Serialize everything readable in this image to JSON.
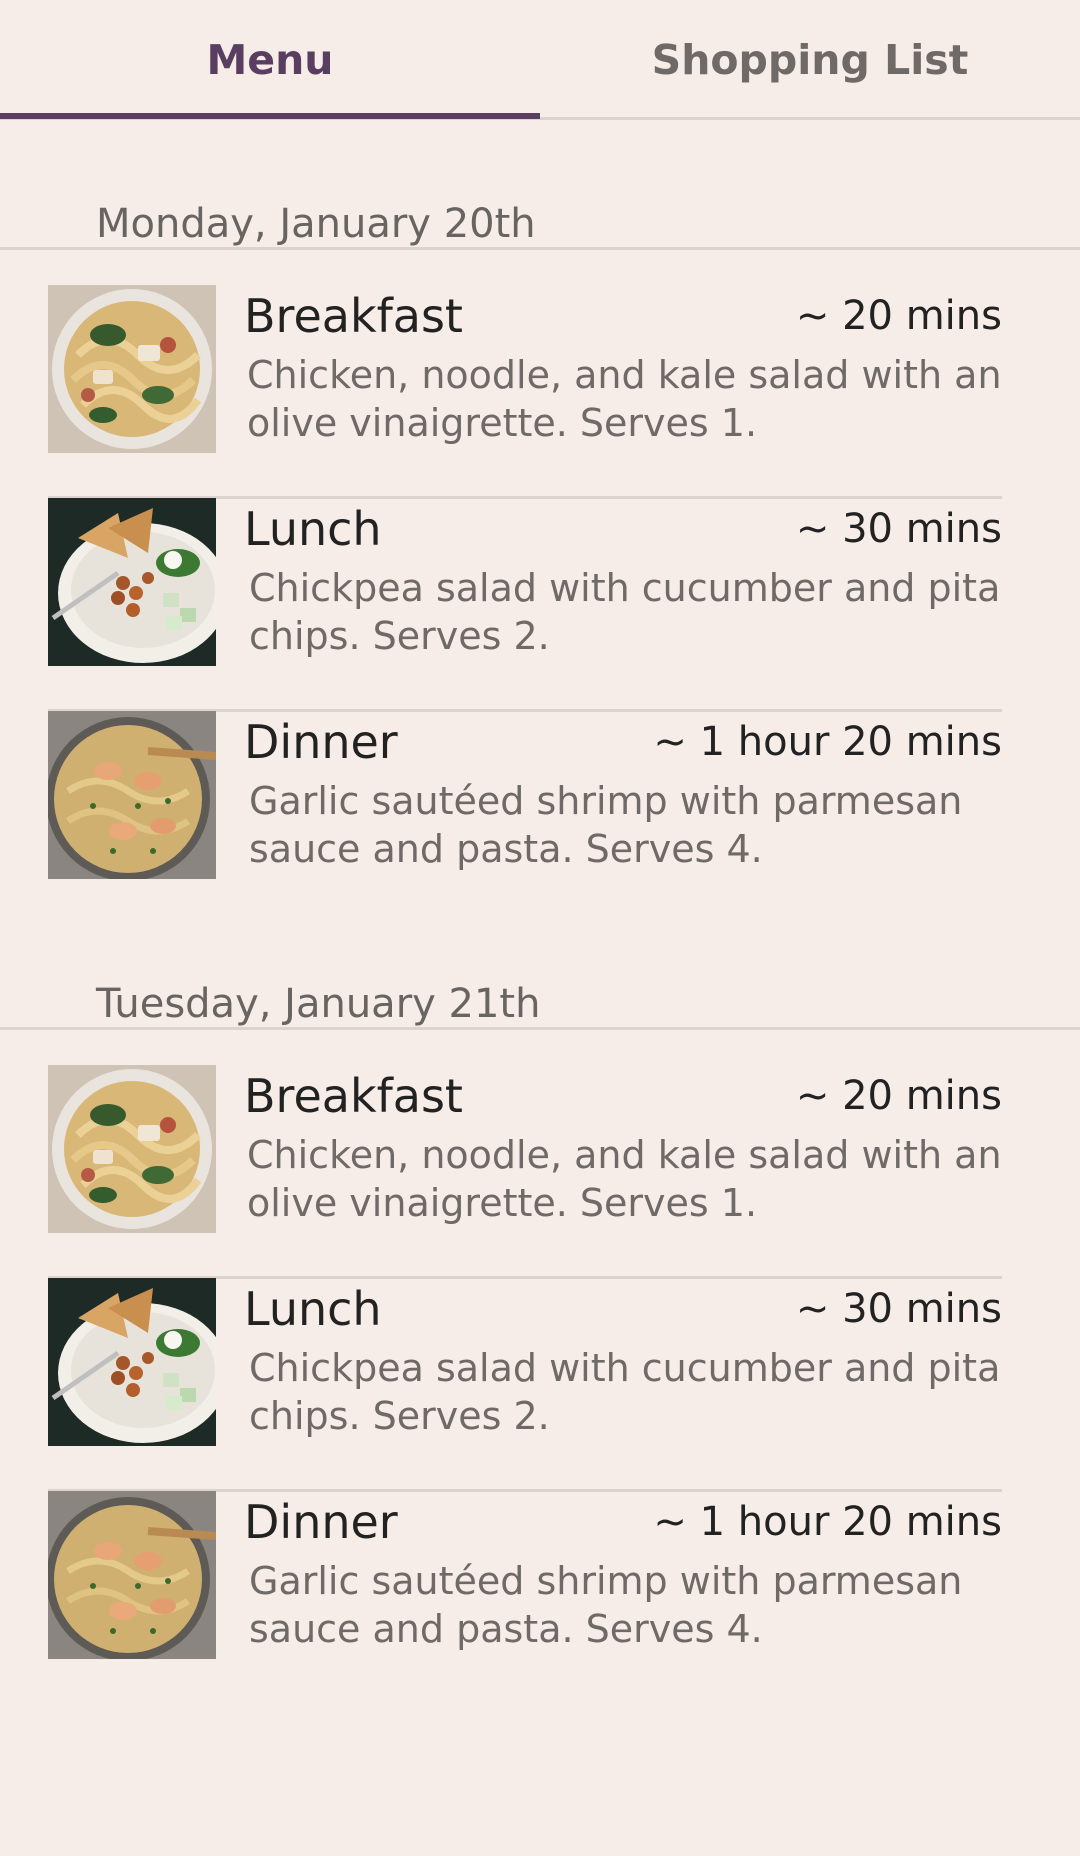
{
  "tabs": [
    {
      "label": "Menu",
      "active": true
    },
    {
      "label": "Shopping List",
      "active": false
    }
  ],
  "colors": {
    "accent": "#5a3e62",
    "background": "#f6ece8",
    "divider": "#dcd2ce"
  },
  "days": [
    {
      "date": "Monday, January 20th",
      "meals": [
        {
          "title": "Breakfast",
          "time": "~ 20 mins",
          "description": "Chicken, noodle, and kale salad with an olive vinaigrette. Serves 1.",
          "image": "chicken-noodle-kale-salad"
        },
        {
          "title": "Lunch",
          "time": "~ 30 mins",
          "description": "Chickpea salad with cucumber and pita chips. Serves 2.",
          "image": "chickpea-salad"
        },
        {
          "title": "Dinner",
          "time": "~ 1 hour 20 mins",
          "description": "Garlic sautéed shrimp with parmesan sauce and pasta. Serves 4.",
          "image": "shrimp-parmesan-pasta"
        }
      ]
    },
    {
      "date": "Tuesday, January 21th",
      "meals": [
        {
          "title": "Breakfast",
          "time": "~ 20 mins",
          "description": "Chicken, noodle, and kale salad with an olive vinaigrette. Serves 1.",
          "image": "chicken-noodle-kale-salad"
        },
        {
          "title": "Lunch",
          "time": "~ 30 mins",
          "description": "Chickpea salad with cucumber and pita chips. Serves 2.",
          "image": "chickpea-salad"
        },
        {
          "title": "Dinner",
          "time": "~ 1 hour 20 mins",
          "description": "Garlic sautéed shrimp with parmesan sauce and pasta. Serves 4.",
          "image": "shrimp-parmesan-pasta"
        }
      ]
    }
  ]
}
